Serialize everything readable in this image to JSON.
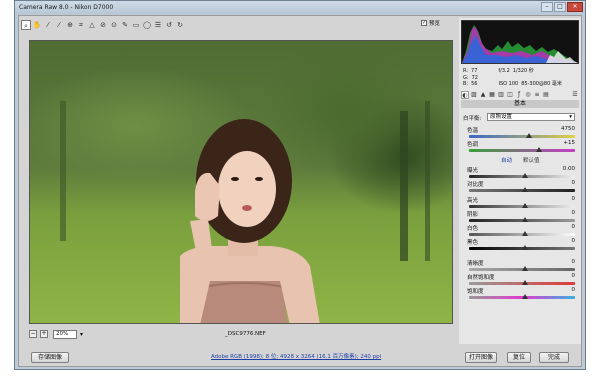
{
  "window": {
    "title": "Camera Raw 8.0 - Nikon D7000"
  },
  "toolbar": {
    "preview_label": "预览"
  },
  "bottombar": {
    "zoom": "20%",
    "filename": "_DSC9776.NEF"
  },
  "footer": {
    "save_button": "存储图像",
    "workflow_link": "Adobe RGB (1998); 8 位; 4928 x 3264 (16.1 百万像素); 240 ppi",
    "open_button": "打开图像",
    "reset_button": "复位",
    "done_button": "完成"
  },
  "readout": {
    "r_label": "R:",
    "r_value": "77",
    "g_label": "G:",
    "g_value": "72",
    "b_label": "B:",
    "b_value": "56",
    "aperture": "f/3.2",
    "shutter": "1/320 秒",
    "iso": "ISO 100",
    "lens": "85-300@80 毫米"
  },
  "panel": {
    "title": "基本",
    "wb_label": "白平衡:",
    "wb_value": "原照设置",
    "temp_label": "色温",
    "temp_value": "4750",
    "tint_label": "色调",
    "tint_value": "+15",
    "auto_link": "自动",
    "default_link": "默认值",
    "exposure_label": "曝光",
    "exposure_value": "0.00",
    "contrast_label": "对比度",
    "contrast_value": "0",
    "highlights_label": "高光",
    "highlights_value": "0",
    "shadows_label": "阴影",
    "shadows_value": "0",
    "whites_label": "白色",
    "whites_value": "0",
    "blacks_label": "黑色",
    "blacks_value": "0",
    "clarity_label": "清晰度",
    "clarity_value": "0",
    "vibrance_label": "自然饱和度",
    "vibrance_value": "0",
    "saturation_label": "饱和度",
    "saturation_value": "0"
  },
  "colors": {
    "titlebar": "#c4d2e0",
    "close": "#c8473b",
    "link": "#1d3fa6"
  },
  "icons": [
    "zoom-icon",
    "hand-icon",
    "white-balance-icon",
    "color-sampler-icon",
    "target-adjust-icon",
    "crop-icon",
    "straighten-icon",
    "spot-removal-icon",
    "red-eye-icon",
    "adjustment-brush-icon",
    "graduated-filter-icon",
    "radial-filter-icon",
    "preferences-icon",
    "rotate-left-icon",
    "rotate-right-icon"
  ]
}
